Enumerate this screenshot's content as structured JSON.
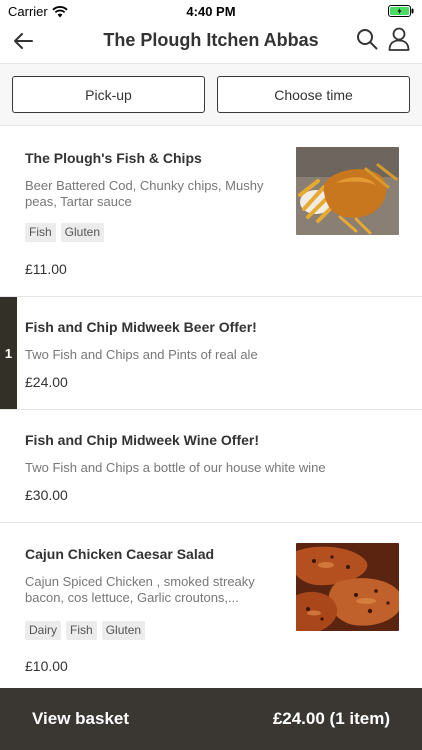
{
  "status_bar": {
    "carrier": "Carrier",
    "time": "4:40 PM"
  },
  "nav": {
    "title": "The Plough Itchen Abbas"
  },
  "options": {
    "pickup_label": "Pick-up",
    "time_label": "Choose time"
  },
  "items": [
    {
      "name": "The Plough's Fish & Chips",
      "description": "Beer Battered Cod, Chunky chips, Mushy peas, Tartar sauce",
      "tags": [
        "Fish",
        "Gluten"
      ],
      "price": "£11.00"
    },
    {
      "name": "Fish and Chip Midweek Beer Offer!",
      "description": "Two Fish and Chips and Pints of real ale",
      "price": "£24.00",
      "quantity": "1"
    },
    {
      "name": "Fish and Chip Midweek Wine Offer!",
      "description": "Two Fish and Chips a bottle of our house white wine",
      "price": "£30.00"
    },
    {
      "name": "Cajun Chicken Caesar Salad",
      "description": "Cajun Spiced Chicken , smoked streaky bacon, cos lettuce, Garlic croutons,...",
      "tags": [
        "Dairy",
        "Fish",
        "Gluten"
      ],
      "price": "£10.00"
    }
  ],
  "basket": {
    "label": "View basket",
    "total": "£24.00 (1 item)"
  },
  "colors": {
    "dark": "#3a3732",
    "accent_battery": "#4cd964"
  },
  "icons": [
    "wifi-icon",
    "battery-icon",
    "back-arrow-icon",
    "search-icon",
    "user-icon"
  ]
}
